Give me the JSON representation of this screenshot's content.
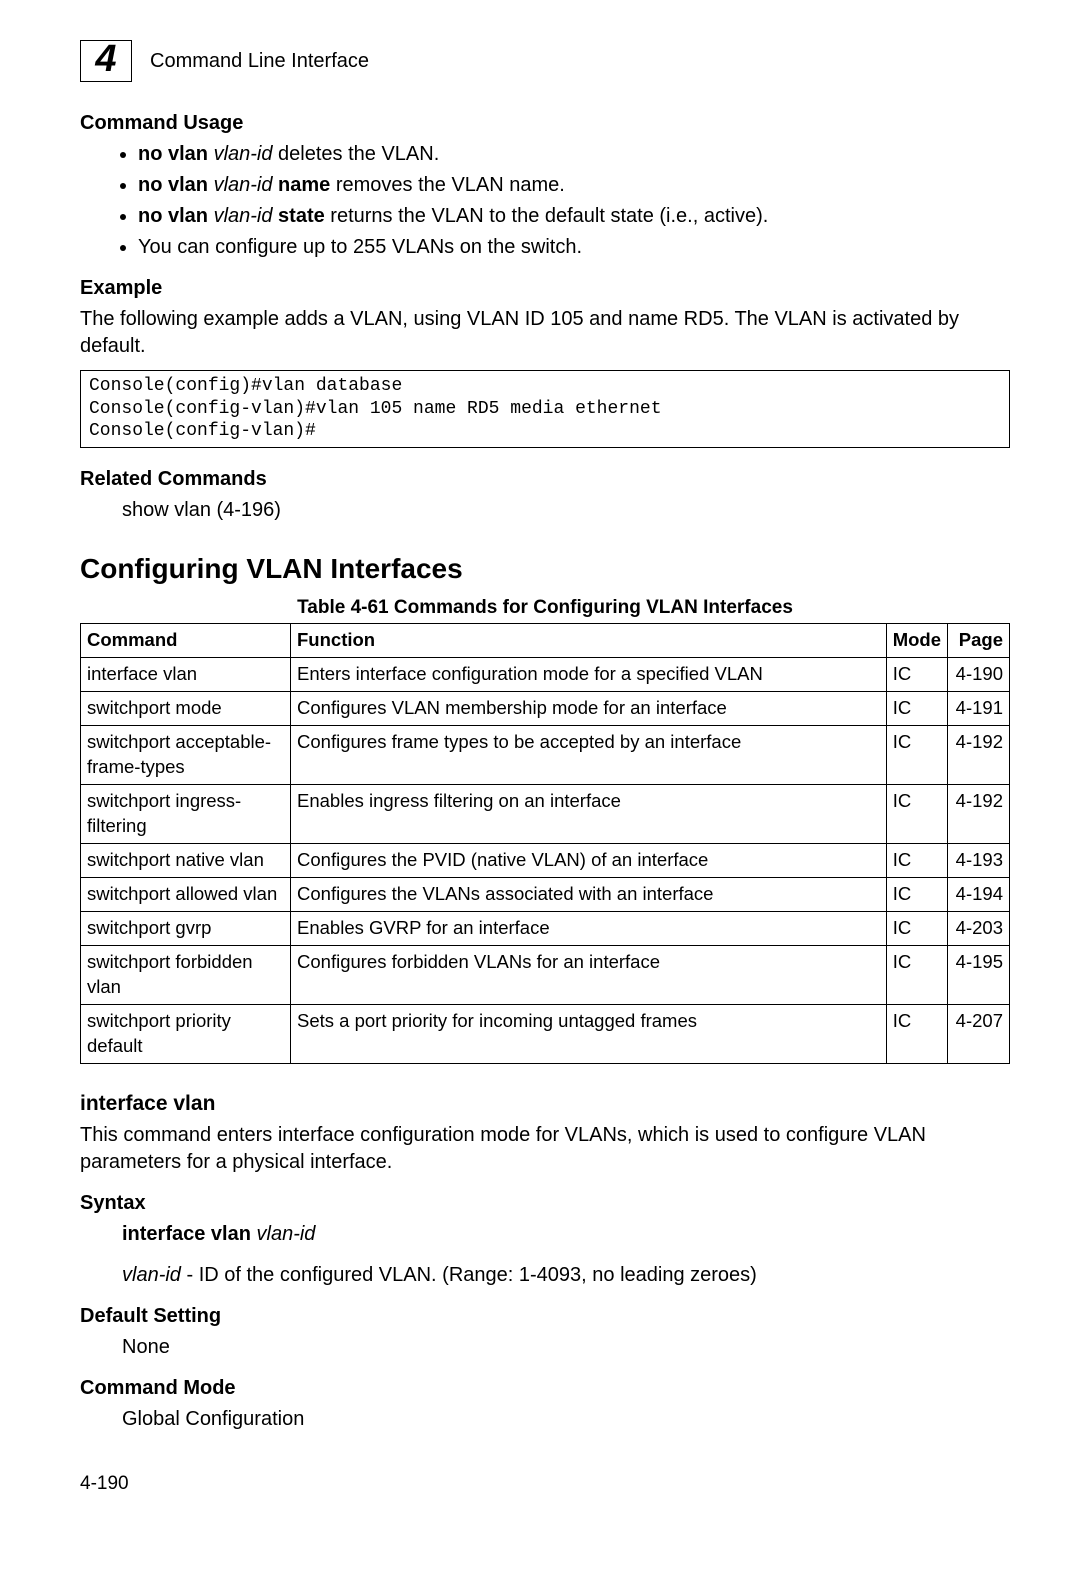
{
  "header": {
    "chapter_number": "4",
    "title": "Command Line Interface"
  },
  "command_usage": {
    "heading": "Command Usage",
    "items": [
      {
        "pre_bold": "no vlan",
        "pre_italic": " vlan-id",
        "rest": " deletes the VLAN."
      },
      {
        "pre_bold": "no vlan",
        "pre_italic": " vlan-id ",
        "mid_bold": "name",
        "rest": " removes the VLAN name."
      },
      {
        "pre_bold": "no vlan",
        "pre_italic": " vlan-id ",
        "mid_bold": "state",
        "rest": " returns the VLAN to the default state (i.e., active)."
      },
      {
        "rest_only": "You can configure up to 255 VLANs on the switch."
      }
    ]
  },
  "example": {
    "heading": "Example",
    "intro": "The following example adds a VLAN, using VLAN ID 105 and name RD5. The VLAN is activated by default.",
    "console": "Console(config)#vlan database\nConsole(config-vlan)#vlan 105 name RD5 media ethernet\nConsole(config-vlan)#"
  },
  "related": {
    "heading": "Related Commands",
    "text": "show vlan (4-196)"
  },
  "config_section": {
    "title": "Configuring VLAN Interfaces",
    "table_caption": "Table 4-61   Commands for Configuring VLAN Interfaces",
    "headers": {
      "command": "Command",
      "function": "Function",
      "mode": "Mode",
      "page": "Page"
    },
    "rows": [
      {
        "command": "interface vlan",
        "function": "Enters interface configuration mode for a specified VLAN",
        "mode": "IC",
        "page": "4-190"
      },
      {
        "command": "switchport mode",
        "function": "Configures VLAN membership mode for an interface",
        "mode": "IC",
        "page": "4-191"
      },
      {
        "command": "switchport acceptable-frame-types",
        "function": "Configures frame types to be accepted by an interface",
        "mode": "IC",
        "page": "4-192"
      },
      {
        "command": "switchport ingress-filtering",
        "function": "Enables ingress filtering on an interface",
        "mode": "IC",
        "page": "4-192"
      },
      {
        "command": "switchport native vlan",
        "function": "Configures the PVID (native VLAN) of an interface",
        "mode": "IC",
        "page": "4-193"
      },
      {
        "command": "switchport allowed vlan",
        "function": "Configures the VLANs associated with an interface",
        "mode": "IC",
        "page": "4-194"
      },
      {
        "command": "switchport gvrp",
        "function": "Enables GVRP for an interface",
        "mode": "IC",
        "page": "4-203"
      },
      {
        "command": "switchport forbidden vlan",
        "function": "Configures forbidden VLANs for an interface",
        "mode": "IC",
        "page": "4-195"
      },
      {
        "command": "switchport priority default",
        "function": "Sets a port priority for incoming untagged frames",
        "mode": "IC",
        "page": "4-207"
      }
    ]
  },
  "interface_vlan": {
    "heading": "interface vlan",
    "description": "This command enters interface configuration mode for VLANs, which is used to configure VLAN parameters for a physical interface.",
    "syntax_heading": "Syntax",
    "syntax_bold": "interface vlan",
    "syntax_italic": " vlan-id",
    "param_italic": "vlan-id",
    "param_rest": " - ID of the configured VLAN. (Range: 1-4093, no leading zeroes)",
    "default_heading": "Default Setting",
    "default_value": "None",
    "mode_heading": "Command Mode",
    "mode_value": "Global Configuration"
  },
  "footer": {
    "page": "4-190"
  }
}
